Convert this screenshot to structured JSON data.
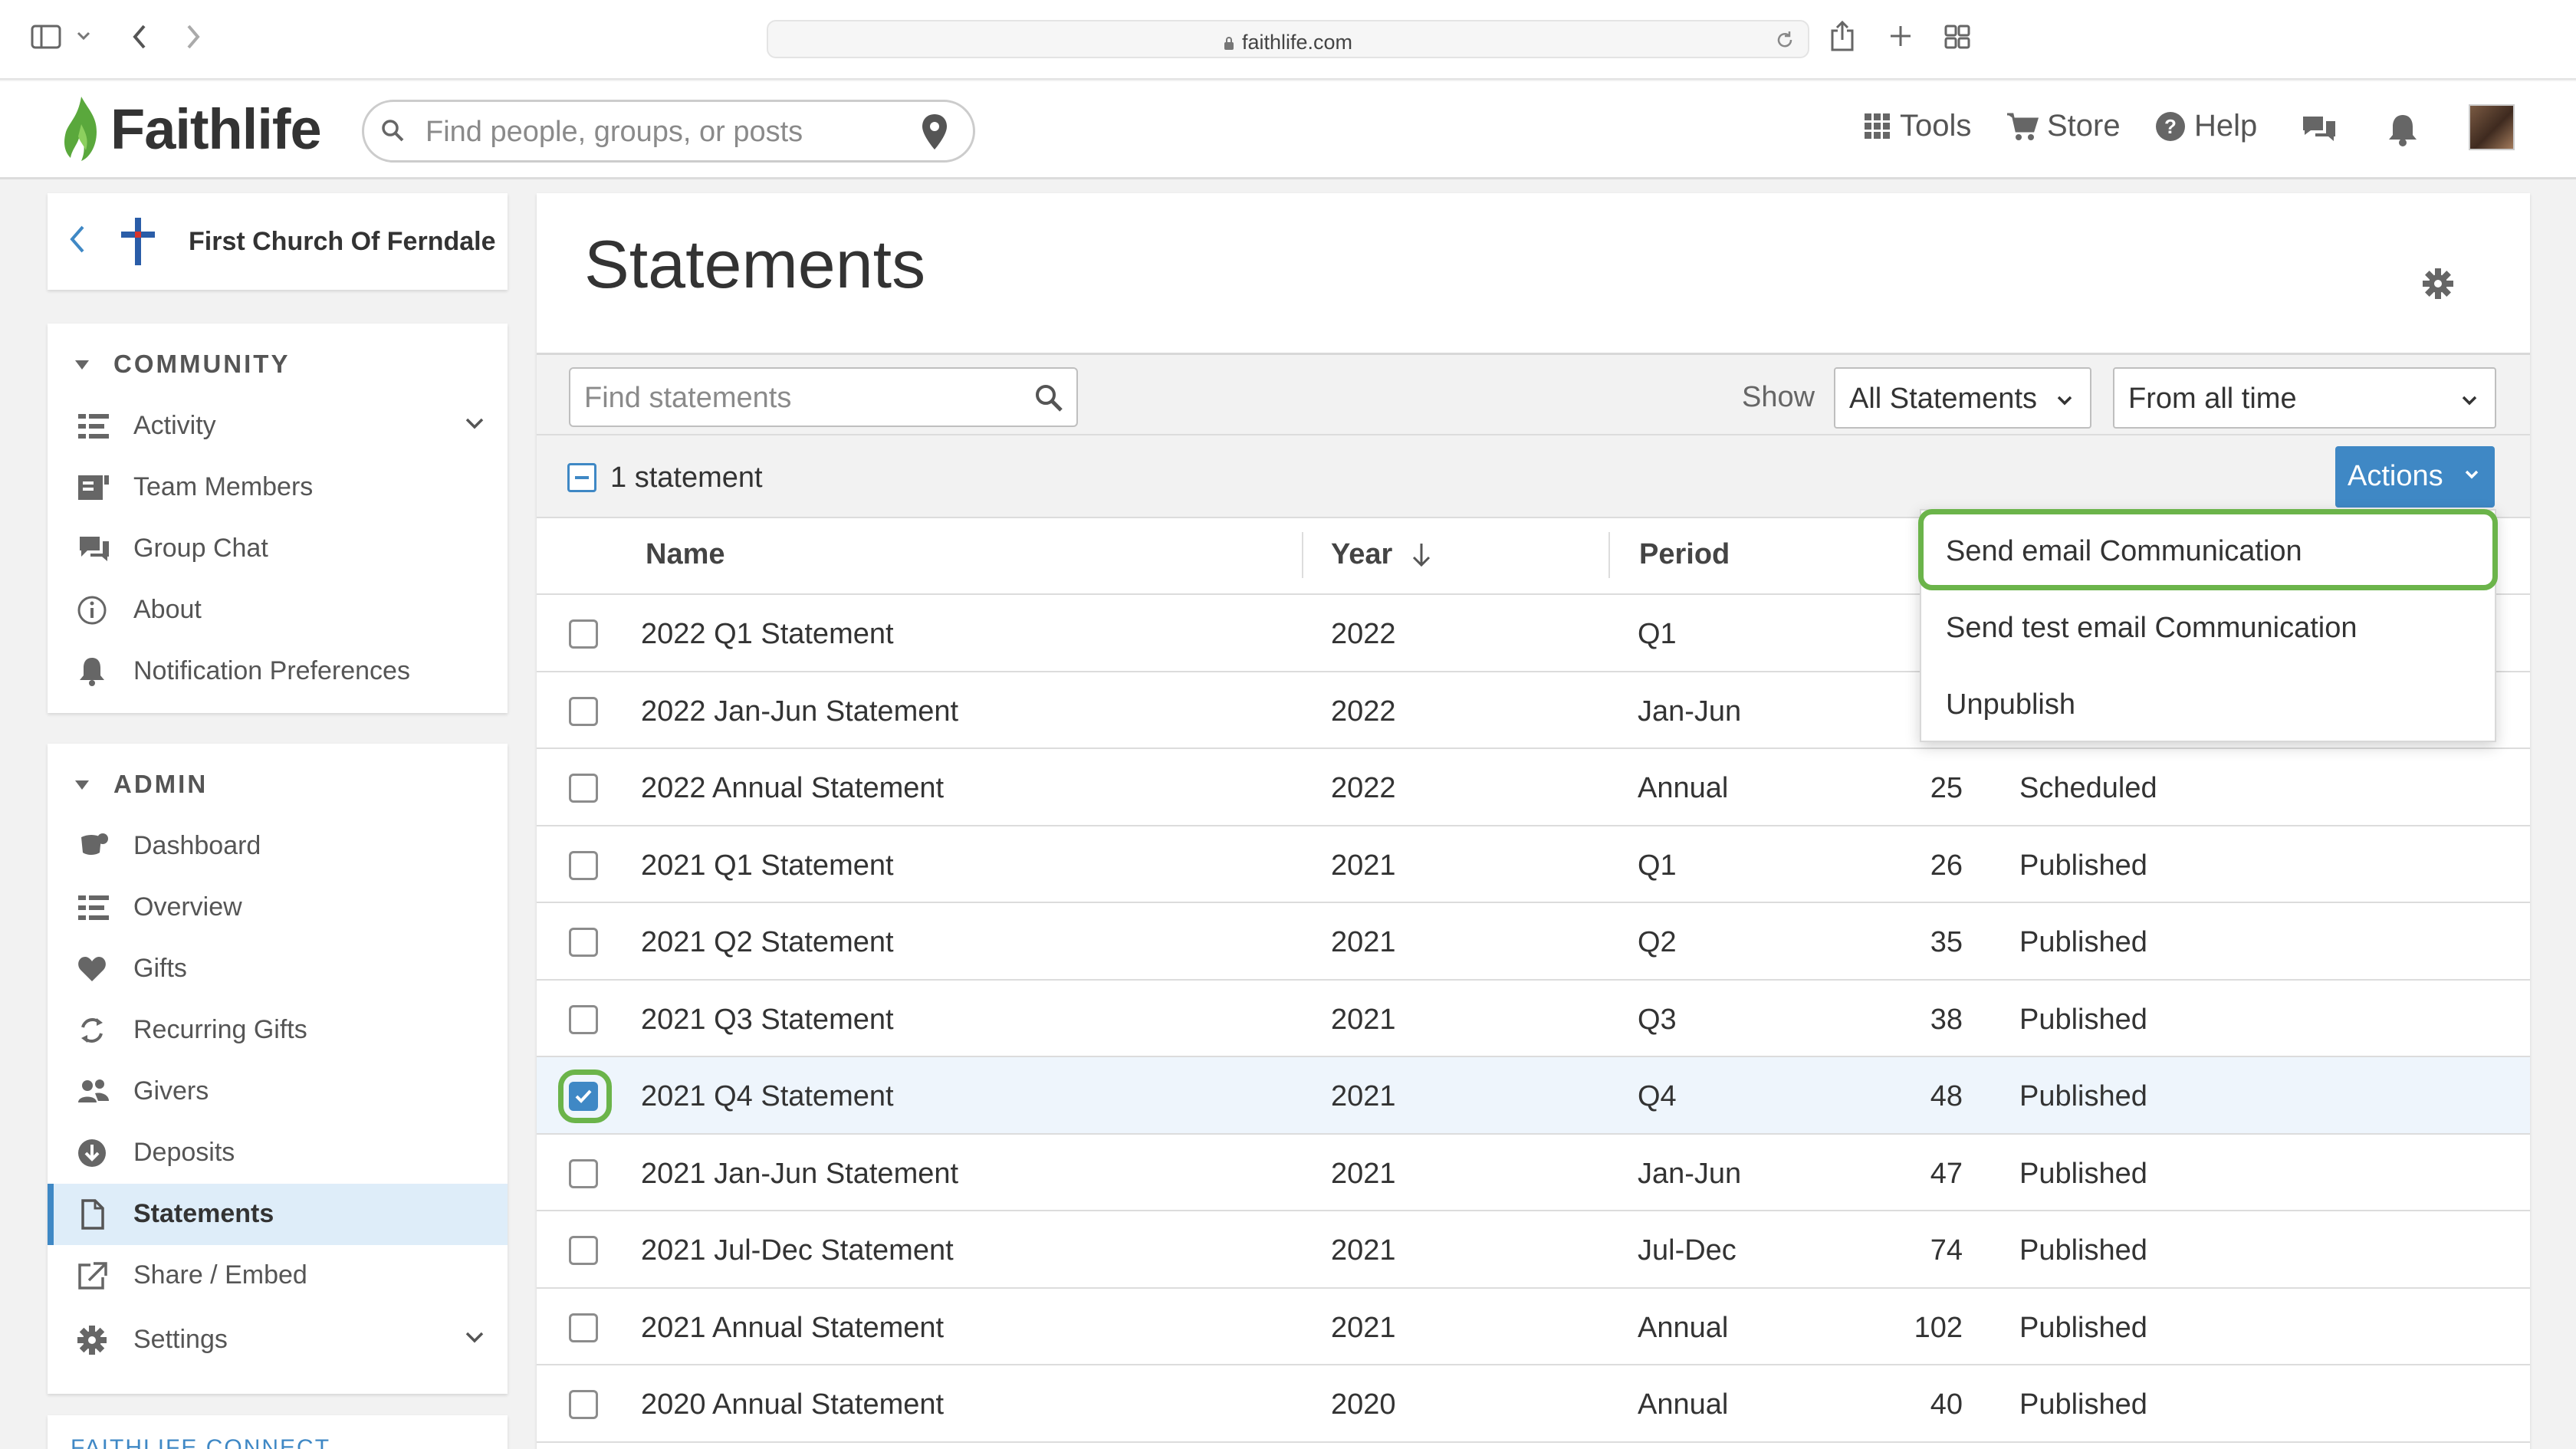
{
  "browser": {
    "url": "faithlife.com"
  },
  "header": {
    "brand": "Faithlife",
    "search_placeholder": "Find people, groups, or posts",
    "nav": {
      "tools": "Tools",
      "store": "Store",
      "help": "Help"
    }
  },
  "sidebar": {
    "church_name": "First Church Of Ferndale",
    "community_title": "COMMUNITY",
    "community_items": [
      {
        "label": "Activity",
        "icon": "activity-icon"
      },
      {
        "label": "Team Members",
        "icon": "team-members-icon"
      },
      {
        "label": "Group Chat",
        "icon": "chat-icon"
      },
      {
        "label": "About",
        "icon": "info-icon"
      },
      {
        "label": "Notification Preferences",
        "icon": "bell-icon"
      }
    ],
    "admin_title": "ADMIN",
    "admin_items": [
      {
        "label": "Dashboard",
        "icon": "dashboard-icon"
      },
      {
        "label": "Overview",
        "icon": "overview-icon"
      },
      {
        "label": "Gifts",
        "icon": "heart-icon"
      },
      {
        "label": "Recurring Gifts",
        "icon": "recurring-icon"
      },
      {
        "label": "Givers",
        "icon": "givers-icon"
      },
      {
        "label": "Deposits",
        "icon": "deposit-icon"
      },
      {
        "label": "Statements",
        "icon": "document-icon"
      },
      {
        "label": "Share / Embed",
        "icon": "share-icon"
      },
      {
        "label": "Settings",
        "icon": "gear-icon"
      }
    ],
    "connect_title": "FAITHLIFE CONNECT"
  },
  "main": {
    "title": "Statements",
    "find_placeholder": "Find statements",
    "show_label": "Show",
    "filter_type": "All Statements",
    "filter_time": "From all time",
    "selection_count": "1 statement",
    "actions_label": "Actions",
    "columns": {
      "name": "Name",
      "year": "Year",
      "period": "Period"
    },
    "actions_menu": [
      "Send email Communication",
      "Send test email Communication",
      "Unpublish"
    ],
    "rows": [
      {
        "name": "2022 Q1 Statement",
        "year": "2022",
        "period": "Q1",
        "count": "",
        "status": "",
        "checked": false
      },
      {
        "name": "2022 Jan-Jun Statement",
        "year": "2022",
        "period": "Jan-Jun",
        "count": "",
        "status": "",
        "checked": false
      },
      {
        "name": "2022 Annual Statement",
        "year": "2022",
        "period": "Annual",
        "count": "25",
        "status": "Scheduled",
        "checked": false
      },
      {
        "name": "2021 Q1 Statement",
        "year": "2021",
        "period": "Q1",
        "count": "26",
        "status": "Published",
        "checked": false
      },
      {
        "name": "2021 Q2 Statement",
        "year": "2021",
        "period": "Q2",
        "count": "35",
        "status": "Published",
        "checked": false
      },
      {
        "name": "2021 Q3 Statement",
        "year": "2021",
        "period": "Q3",
        "count": "38",
        "status": "Published",
        "checked": false
      },
      {
        "name": "2021 Q4 Statement",
        "year": "2021",
        "period": "Q4",
        "count": "48",
        "status": "Published",
        "checked": true
      },
      {
        "name": "2021 Jan-Jun Statement",
        "year": "2021",
        "period": "Jan-Jun",
        "count": "47",
        "status": "Published",
        "checked": false
      },
      {
        "name": "2021 Jul-Dec Statement",
        "year": "2021",
        "period": "Jul-Dec",
        "count": "74",
        "status": "Published",
        "checked": false
      },
      {
        "name": "2021 Annual Statement",
        "year": "2021",
        "period": "Annual",
        "count": "102",
        "status": "Published",
        "checked": false
      },
      {
        "name": "2020 Annual Statement",
        "year": "2020",
        "period": "Annual",
        "count": "40",
        "status": "Published",
        "checked": false
      }
    ]
  },
  "colors": {
    "accent": "#3f88c5",
    "highlight": "#6bb44a",
    "brand_green": "#5aa83c",
    "selected_row": "#eef5fc"
  }
}
